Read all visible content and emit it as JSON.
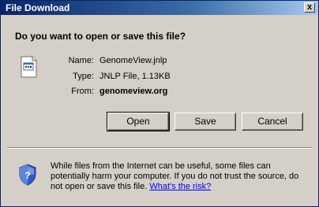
{
  "window": {
    "title": "File Download",
    "close_label": "x"
  },
  "question": "Do you want to open or save this file?",
  "file": {
    "name_label": "Name:",
    "name": "GenomeView.jnlp",
    "type_label": "Type:",
    "type": "JNLP File, 1.13KB",
    "from_label": "From:",
    "from": "genomeview.org"
  },
  "buttons": {
    "open": "Open",
    "save": "Save",
    "cancel": "Cancel"
  },
  "warning": {
    "text": "While files from the Internet can be useful, some files can potentially harm your computer. If you do not trust the source, do not open or save this file. ",
    "link": "What's the risk?"
  },
  "icons": {
    "file": "jnlp-file-icon",
    "shield": "security-shield-icon"
  },
  "colors": {
    "titlebar": "#0a246a",
    "dialog_bg": "#d4d0c8",
    "link": "#0000ff"
  }
}
